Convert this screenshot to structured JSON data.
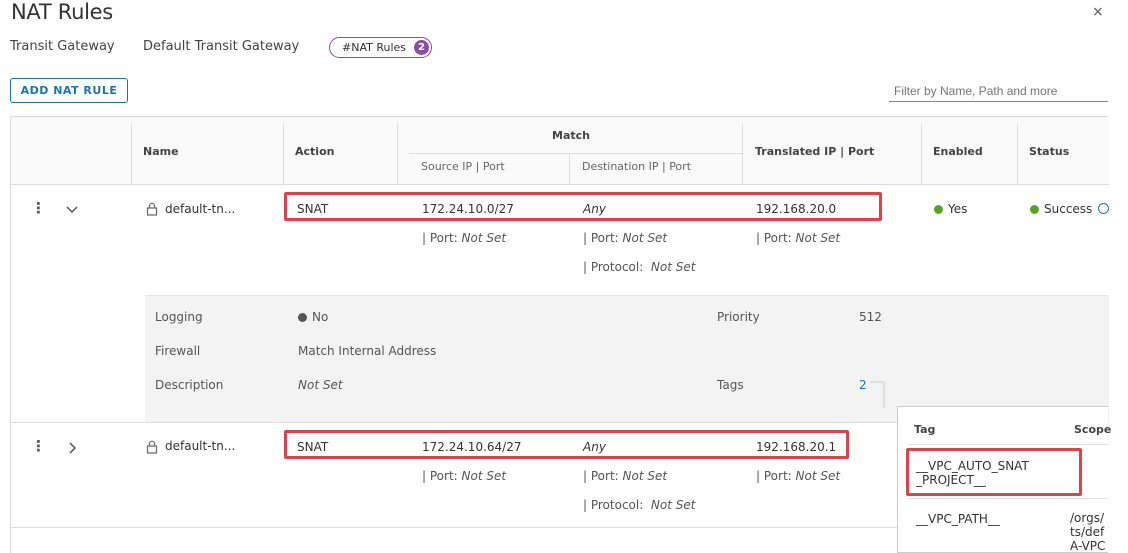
{
  "title": "NAT Rules",
  "close_label": "×",
  "breadcrumb": {
    "label": "Transit Gateway",
    "value": "Default Transit Gateway",
    "badge_label": "#NAT Rules",
    "badge_count": "2"
  },
  "toolbar": {
    "add_label": "ADD NAT RULE",
    "filter_placeholder": "Filter by Name, Path and more"
  },
  "columns": {
    "name": "Name",
    "action": "Action",
    "match": "Match",
    "source": "Source IP | Port",
    "destination": "Destination IP | Port",
    "translated": "Translated IP | Port",
    "enabled": "Enabled",
    "status": "Status"
  },
  "rows": [
    {
      "name": "default-tn...",
      "action": "SNAT",
      "source_ip": "172.24.10.0/27",
      "dest_ip": "Any",
      "translated_ip": "192.168.20.0",
      "port_label": "| Port:",
      "port_value": "Not Set",
      "protocol_label": "| Protocol:",
      "protocol_value": "Not Set",
      "enabled": "Yes",
      "status": "Success"
    },
    {
      "name": "default-tn...",
      "action": "SNAT",
      "source_ip": "172.24.10.64/27",
      "dest_ip": "Any",
      "translated_ip": "192.168.20.1",
      "port_label": "| Port:",
      "port_value": "Not Set",
      "protocol_label": "| Protocol:",
      "protocol_value": "Not Set"
    }
  ],
  "details": {
    "logging_label": "Logging",
    "logging_value": "No",
    "firewall_label": "Firewall",
    "firewall_value": "Match Internal Address",
    "description_label": "Description",
    "description_value": "Not Set",
    "priority_label": "Priority",
    "priority_value": "512",
    "tags_label": "Tags",
    "tags_value": "2"
  },
  "tags_popover": {
    "tag_header": "Tag",
    "scope_header": "Scope",
    "rows": [
      {
        "tag_line1": "__VPC_AUTO_SNAT",
        "tag_line2": "_PROJECT__",
        "scope": ""
      },
      {
        "tag_line1": "__VPC_PATH__",
        "scope_line1": "/orgs/",
        "scope_line2": "ts/def",
        "scope_line3": "A-VPC"
      }
    ]
  }
}
